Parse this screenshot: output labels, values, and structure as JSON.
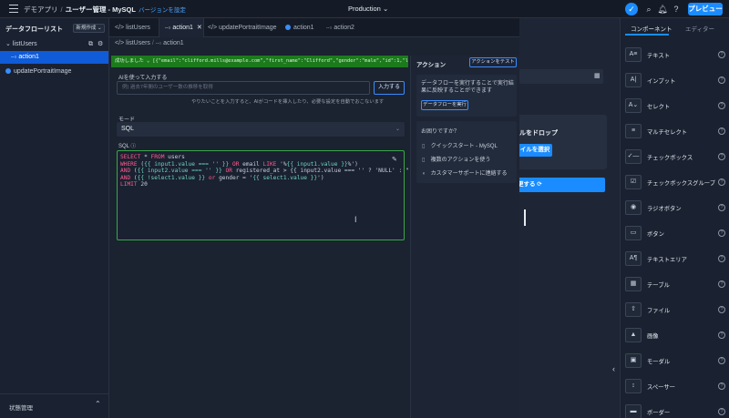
{
  "header": {
    "breadcrumb_home": "デモアプリ",
    "separator": "/",
    "app_title": "ユーザー管理 - MySQL",
    "version_label": "バージョンを設定",
    "environment": "Production",
    "preview_label": "プレビュー"
  },
  "left_sidebar": {
    "title": "データフローリスト",
    "new_button": "新規作成",
    "items": [
      {
        "label": "listUsers"
      },
      {
        "label": "action1"
      },
      {
        "label": "updatePortraitImage"
      }
    ],
    "bottom_label": "状態管理"
  },
  "tabs": [
    {
      "label": "listUsers"
    },
    {
      "label": "action1"
    },
    {
      "label": "updatePortraitImage"
    },
    {
      "label": "action1"
    },
    {
      "label": "action2"
    }
  ],
  "editor": {
    "breadcrumb_parent": "listUsers",
    "breadcrumb_child": "action1",
    "result_text": "成功しました  ⌄  [{\"email\":\"clifford.mills@example.com\",\"first_name\":\"Clifford\",\"gender\":\"male\",\"id\":1,\"last_name\":\"Mills\",\"portrait\":\"http",
    "ai_label": "AIを使って入力する",
    "ai_placeholder": "例) 過去7年間のユーザー数の推移を取得",
    "ai_button": "入力する",
    "ai_help": "やりたいことを入力すると、AIがコードを挿入したり、必要な設定を自動でおこないます",
    "mode_label": "モード",
    "mode_value": "SQL",
    "sql_label": "SQL",
    "code_lines": [
      "SELECT * FROM users",
      "WHERE ({{ input1.value === '' }} OR email LIKE '%{{ input1.value }}%')",
      "AND ({{ input2.value === '' }} OR registered_at > {{ input2.value === '' ? 'NULL' : \"'\" + i",
      "AND ({{ !select1.value }} or gender = '{{ select1.value }}')",
      "LIMIT 20"
    ]
  },
  "actions_panel": {
    "title": "アクション",
    "test_button": "アクションをテスト",
    "card_text": "データフローを実行することで実行結果に反映することができます",
    "flow_button": "データフローを実行",
    "help_title": "お困りですか？",
    "help_items": [
      {
        "label": "クイックスタート - MySQL",
        "icon": "book-icon"
      },
      {
        "label": "複数のアクションを使う",
        "icon": "book-icon"
      },
      {
        "label": "カスタマーサポートに連絡する",
        "icon": "headset-icon"
      }
    ]
  },
  "canvas": {
    "drop_title": "ルをドロップ",
    "file_button": "イルを選択",
    "run_button": "更する"
  },
  "right_sidebar": {
    "tabs": [
      {
        "label": "コンポーネント"
      },
      {
        "label": "エディター"
      }
    ],
    "components": [
      {
        "label": "テキスト",
        "icon": "text-icon"
      },
      {
        "label": "インプット",
        "icon": "input-icon"
      },
      {
        "label": "セレクト",
        "icon": "select-icon"
      },
      {
        "label": "マルチセレクト",
        "icon": "multiselect-icon"
      },
      {
        "label": "チェックボックス",
        "icon": "checkbox-icon"
      },
      {
        "label": "チェックボックスグループ",
        "icon": "checkbox-group-icon"
      },
      {
        "label": "ラジオボタン",
        "icon": "radio-icon"
      },
      {
        "label": "ボタン",
        "icon": "button-icon"
      },
      {
        "label": "テキストエリア",
        "icon": "textarea-icon"
      },
      {
        "label": "テーブル",
        "icon": "table-icon"
      },
      {
        "label": "ファイル",
        "icon": "file-icon"
      },
      {
        "label": "画像",
        "icon": "image-icon"
      },
      {
        "label": "モーダル",
        "icon": "modal-icon"
      },
      {
        "label": "スペーサー",
        "icon": "spacer-icon"
      },
      {
        "label": "ボーダー",
        "icon": "border-icon"
      }
    ]
  },
  "colors": {
    "accent": "#1a8cff",
    "success": "#1c7a1c",
    "background": "#1b2230"
  }
}
